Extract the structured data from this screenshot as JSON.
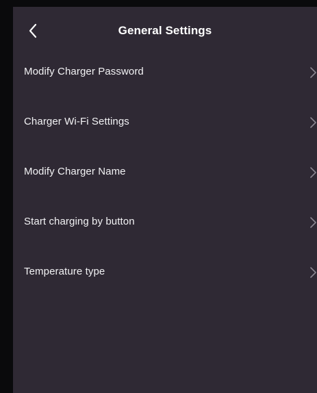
{
  "header": {
    "back_icon": "chevron-left-icon",
    "title": "General Settings"
  },
  "settings": {
    "items": [
      {
        "label": "Modify Charger Password",
        "icon": "chevron-right-icon"
      },
      {
        "label": "Charger Wi-Fi Settings",
        "icon": "chevron-right-icon"
      },
      {
        "label": "Modify Charger Name",
        "icon": "chevron-right-icon"
      },
      {
        "label": "Start charging by button",
        "icon": "chevron-right-icon"
      },
      {
        "label": "Temperature type",
        "icon": "chevron-right-icon"
      }
    ]
  },
  "colors": {
    "background": "#2f2934",
    "bezel": "#0a0a0c",
    "text": "#ffffff",
    "chevron": "#8b8690"
  }
}
